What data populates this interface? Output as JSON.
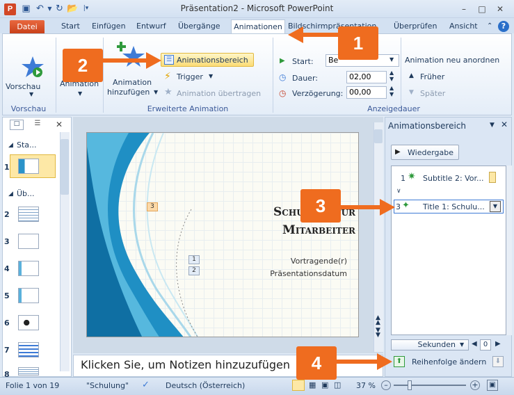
{
  "window": {
    "title": "Präsentation2 - Microsoft PowerPoint",
    "logo": "P"
  },
  "tabs": [
    "Datei",
    "Start",
    "Einfügen",
    "Entwurf",
    "Übergänge",
    "Animationen",
    "Bildschirmpräsentation",
    "Überprüfen",
    "Ansicht"
  ],
  "ribbon": {
    "preview": {
      "label": "Vorschau",
      "group": "Vorschau"
    },
    "animation_label": "Animation",
    "add_anim": {
      "line1": "Animation",
      "line2": "hinzufügen"
    },
    "anim_pane_btn": "Animationsbereich",
    "trigger_btn": "Trigger",
    "anim_painter_btn": "Animation übertragen",
    "adv_group": "Erweiterte Animation",
    "start_label": "Start:",
    "start_value": "Be",
    "duration_label": "Dauer:",
    "duration_value": "02,00",
    "delay_label": "Verzögerung:",
    "delay_value": "00,00",
    "timing_group": "Anzeigedauer",
    "reorder_title": "Animation neu anordnen",
    "earlier": "Früher",
    "later": "Später"
  },
  "left_panel": {
    "section1": "Sta...",
    "section2": "Üb...",
    "slide_numbers": [
      "1",
      "2",
      "3",
      "4",
      "5",
      "6",
      "7",
      "8"
    ]
  },
  "slide": {
    "title_line1": "Schulung für",
    "title_line2": "Mitarbeiter",
    "presenter": "Vortragende(r)",
    "date": "Präsentationsdatum",
    "tag3": "3",
    "tag1": "1",
    "tag2": "2"
  },
  "notes_placeholder": "Klicken Sie, um Notizen hinzuzufügen",
  "anim_pane": {
    "title": "Animationsbereich",
    "play_btn": "Wiedergabe",
    "item1_num": "1",
    "item1_label": "Subtitle 2: Vor...",
    "item3_num": "3",
    "item3_label": "Title 1: Schulu...",
    "seconds": "Sekunden",
    "zero": "0",
    "reorder": "Reihenfolge ändern"
  },
  "status": {
    "slide_info": "Folie 1 von 19",
    "theme": "\"Schulung\"",
    "language": "Deutsch (Österreich)",
    "zoom": "37 %"
  },
  "callouts": [
    "1",
    "2",
    "3",
    "4"
  ],
  "colors": {
    "callout": "#ef6c1f",
    "file_tab": "#d24726",
    "accent": "#2a5592"
  }
}
